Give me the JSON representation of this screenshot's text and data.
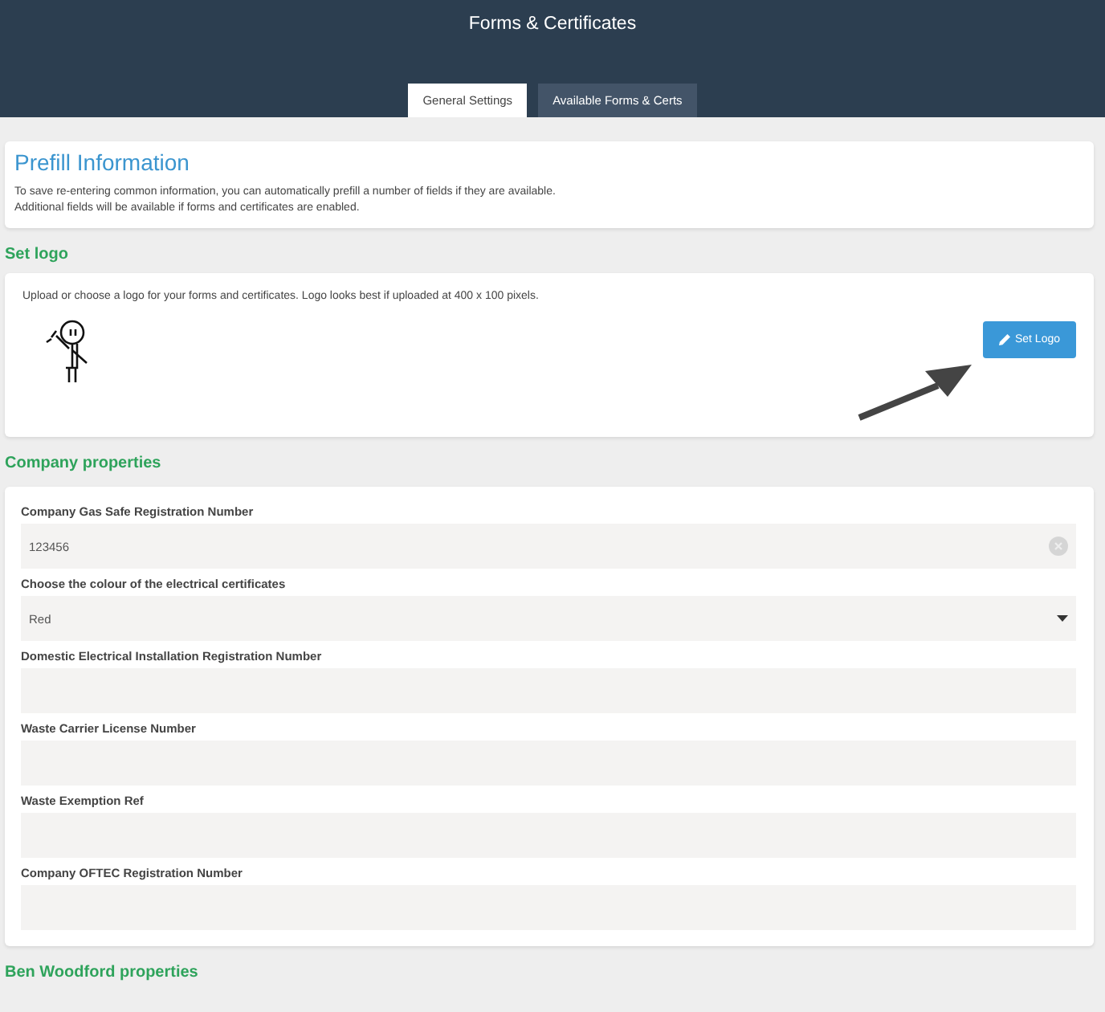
{
  "header": {
    "title": "Forms & Certificates"
  },
  "tabs": [
    {
      "label": "General Settings",
      "selected": true
    },
    {
      "label": "Available Forms & Certs",
      "selected": false
    }
  ],
  "prefill": {
    "title": "Prefill Information",
    "lines": [
      "To save re-entering common information, you can automatically prefill a number of fields if they are available.",
      "Additional fields will be available if forms and certificates are enabled."
    ]
  },
  "set_logo": {
    "heading": "Set logo",
    "description": "Upload or choose a logo for your forms and certificates. Logo looks best if uploaded at 400 x 100 pixels.",
    "button": "Set Logo"
  },
  "company_properties": {
    "heading": "Company properties",
    "fields": [
      {
        "label": "Company Gas Safe Registration Number",
        "value": "123456",
        "kind": "clearable"
      },
      {
        "label": "Choose the colour of the electrical certificates",
        "value": "Red",
        "kind": "select"
      },
      {
        "label": "Domestic Electrical Installation Registration Number",
        "kind": "text"
      },
      {
        "label": "Waste Carrier License Number",
        "kind": "text"
      },
      {
        "label": "Waste Exemption Ref",
        "kind": "text"
      },
      {
        "label": "Company OFTEC Registration Number",
        "kind": "text"
      }
    ]
  },
  "user_properties": {
    "heading": "Ben Woodford properties"
  }
}
